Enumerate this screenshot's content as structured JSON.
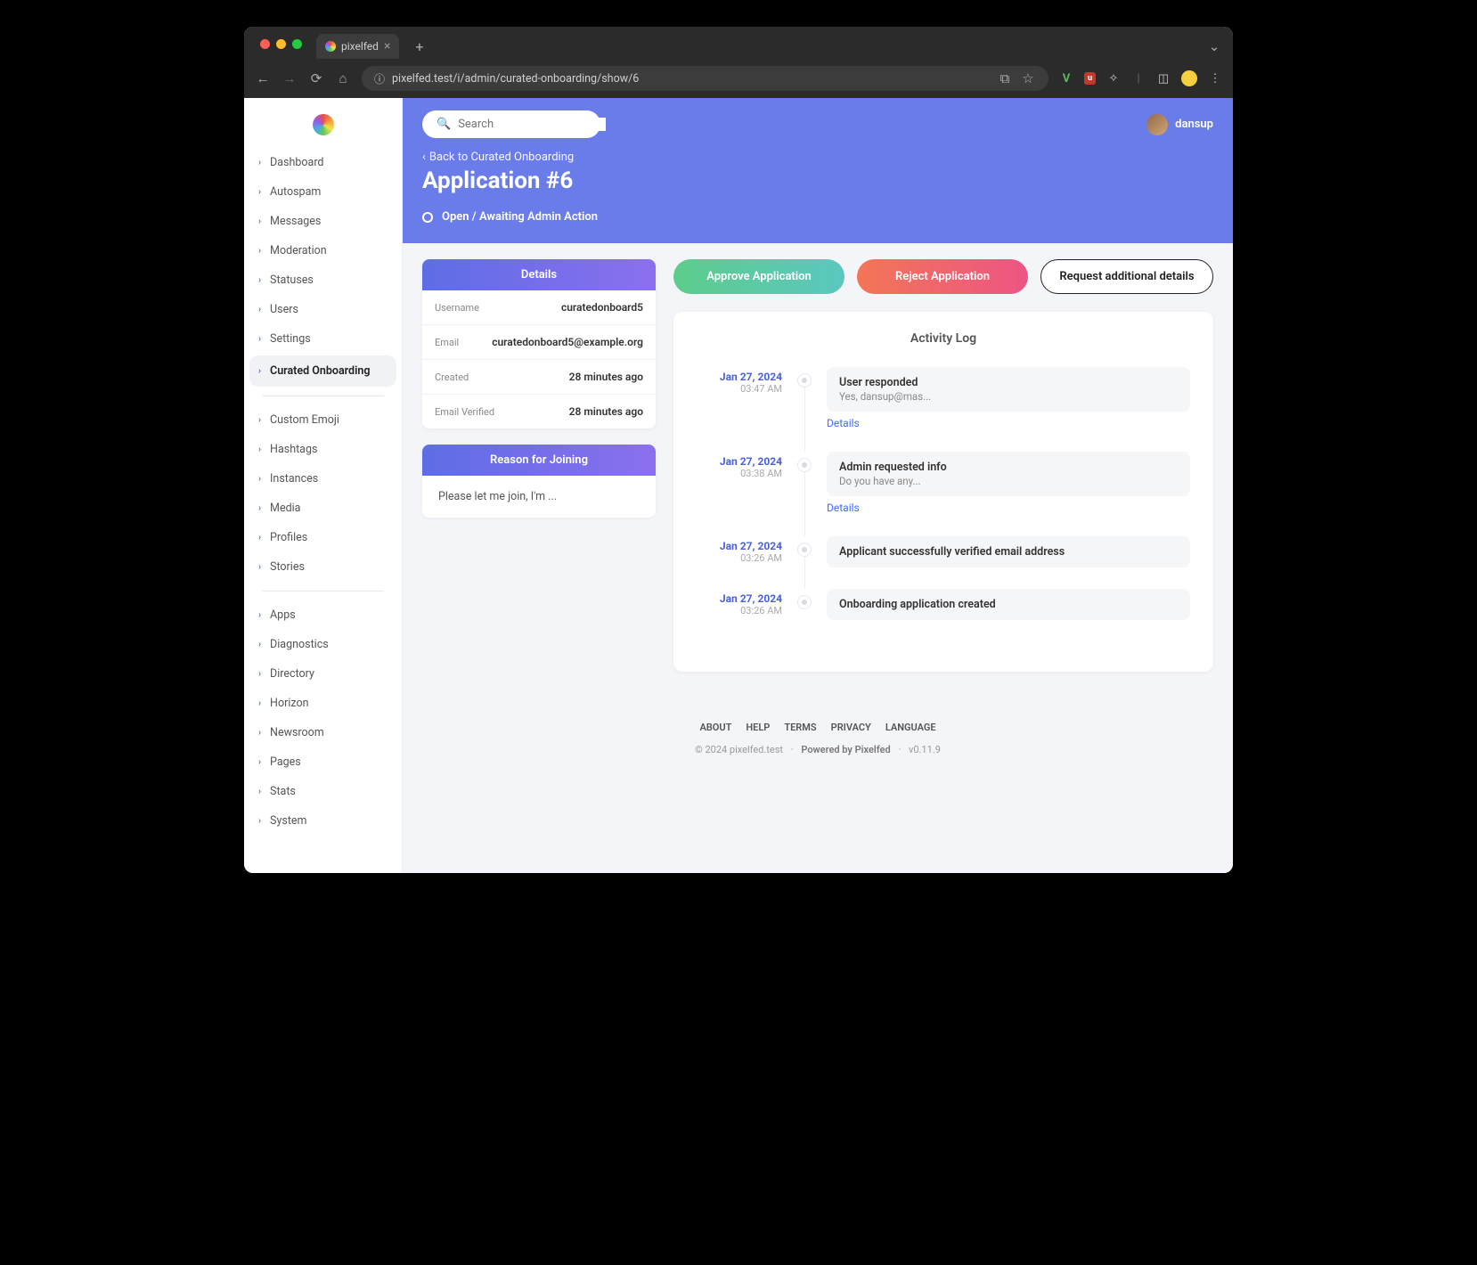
{
  "browser": {
    "tab_title": "pixelfed",
    "url": "pixelfed.test/i/admin/curated-onboarding/show/6"
  },
  "search": {
    "placeholder": "Search"
  },
  "user": {
    "name": "dansup"
  },
  "sidebar": {
    "group1": [
      "Dashboard",
      "Autospam",
      "Messages",
      "Moderation",
      "Statuses",
      "Users",
      "Settings",
      "Curated Onboarding"
    ],
    "group2": [
      "Custom Emoji",
      "Hashtags",
      "Instances",
      "Media",
      "Profiles",
      "Stories"
    ],
    "group3": [
      "Apps",
      "Diagnostics",
      "Directory",
      "Horizon",
      "Newsroom",
      "Pages",
      "Stats",
      "System"
    ],
    "active": "Curated Onboarding"
  },
  "header": {
    "back": "Back to Curated Onboarding",
    "title": "Application #6",
    "status": "Open / Awaiting Admin Action"
  },
  "details": {
    "heading": "Details",
    "rows": [
      {
        "label": "Username",
        "value": "curatedonboard5"
      },
      {
        "label": "Email",
        "value": "curatedonboard5@example.org"
      },
      {
        "label": "Created",
        "value": "28 minutes ago"
      },
      {
        "label": "Email Verified",
        "value": "28 minutes ago"
      }
    ]
  },
  "reason": {
    "heading": "Reason for Joining",
    "text": "Please let me join, I'm ..."
  },
  "actions": {
    "approve": "Approve Application",
    "reject": "Reject Application",
    "request": "Request additional details"
  },
  "activity": {
    "heading": "Activity Log",
    "details_label": "Details",
    "items": [
      {
        "date": "Jan 27, 2024",
        "time": "03:47 AM",
        "title": "User responded",
        "sub": "Yes, dansup@mas...",
        "has_details": true
      },
      {
        "date": "Jan 27, 2024",
        "time": "03:38 AM",
        "title": "Admin requested info",
        "sub": "Do you have any...",
        "has_details": true
      },
      {
        "date": "Jan 27, 2024",
        "time": "03:26 AM",
        "title": "Applicant successfully verified email address",
        "sub": "",
        "has_details": false
      },
      {
        "date": "Jan 27, 2024",
        "time": "03:26 AM",
        "title": "Onboarding application created",
        "sub": "",
        "has_details": false
      }
    ]
  },
  "footer": {
    "links": [
      "ABOUT",
      "HELP",
      "TERMS",
      "PRIVACY",
      "LANGUAGE"
    ],
    "copyright": "© 2024 pixelfed.test",
    "powered": "Powered by Pixelfed",
    "version": "v0.11.9"
  }
}
